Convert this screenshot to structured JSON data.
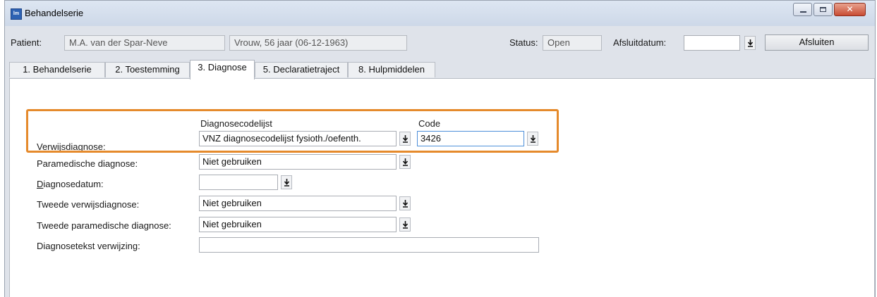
{
  "window": {
    "title": "Behandelserie",
    "app_icon_text": "lm",
    "controls": [
      "minimize-icon",
      "maximize-icon",
      "close-icon"
    ]
  },
  "header": {
    "patient_label": "Patient:",
    "patient_name": "M.A. van der Spar-Neve",
    "patient_info": "Vrouw, 56 jaar (06-12-1963)",
    "status_label": "Status:",
    "status_value": "Open",
    "afsluitdatum_label": "Afsluitdatum:",
    "afsluitdatum_value": "",
    "afsluiten_button": "Afsluiten"
  },
  "tabs": [
    {
      "label": "1. Behandelserie",
      "active": false
    },
    {
      "label": "2. Toestemming",
      "active": false
    },
    {
      "label": "3. Diagnose",
      "active": true
    },
    {
      "label": "5. Declaratietraject",
      "active": false
    },
    {
      "label": "8. Hulpmiddelen",
      "active": false
    }
  ],
  "form": {
    "col_header_list": "Diagnosecodelijst",
    "col_header_code": "Code",
    "verwijsdiagnose_label": "Verwijsdiagnose:",
    "verwijsdiagnose_list": "VNZ diagnosecodelijst fysioth./oefenth.",
    "verwijsdiagnose_code": "3426",
    "paramedische_label": "Paramedische diagnose:",
    "paramedische_value": "Niet gebruiken",
    "diagnosedatum_first_letter": "D",
    "diagnosedatum_rest": "iagnosedatum:",
    "diagnosedatum_value": "",
    "tweede_verwijs_label": "Tweede verwijsdiagnose:",
    "tweede_verwijs_value": "Niet gebruiken",
    "tweede_paramedisch_label": "Tweede paramedische diagnose:",
    "tweede_paramedisch_value": "Niet gebruiken",
    "diagnosetekst_label": "Diagnosetekst verwijzing:",
    "diagnosetekst_value": ""
  },
  "accent": {
    "highlight": "#e58a2c",
    "focus": "#4d8fd9"
  }
}
